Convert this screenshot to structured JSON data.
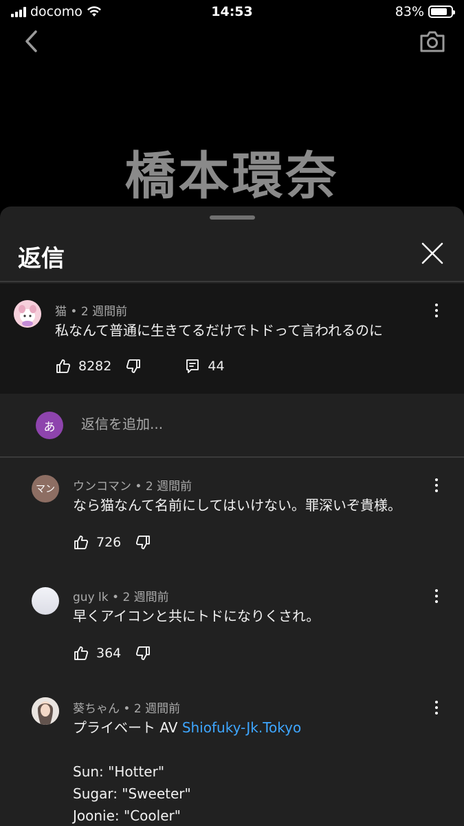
{
  "status_bar": {
    "carrier": "docomo",
    "time": "14:53",
    "battery_percent": "83%",
    "battery_level": 0.83
  },
  "video": {
    "title_overlay": "橋本環奈"
  },
  "sheet": {
    "title": "返信"
  },
  "parent_comment": {
    "author": "猫",
    "time": "2 週間前",
    "text": "私なんて普通に生きてるだけでトドって言われるのに",
    "likes": "8282",
    "replies": "44"
  },
  "add_reply": {
    "avatar_letter": "あ",
    "placeholder": "返信を追加..."
  },
  "replies": [
    {
      "author": "ウンコマン",
      "avatar_text": "マン",
      "time": "2 週間前",
      "text": "なら猫なんて名前にしてはいけない。罪深いぞ貴様。",
      "likes": "726"
    },
    {
      "author": "guy lk",
      "time": "2 週間前",
      "text": "早くアイコンと共にトドになりくされ。",
      "likes": "364"
    },
    {
      "author": "葵ちゃん",
      "time": "2 週間前",
      "text_prefix": "プライベート AV ",
      "link": "Shiofuky-Jk.Tokyo",
      "lines": [
        "Sun: \"Hotter\"",
        "Sugar: \"Sweeter\"",
        "Joonie: \"Cooler\""
      ]
    }
  ],
  "separator": " • ",
  "colors": {
    "sheet_bg": "#212121",
    "parent_bg": "#161616",
    "meta_text": "#aaaaaa",
    "link": "#3ea6ff",
    "add_avatar": "#8e44ad"
  },
  "icons": [
    "signal-icon",
    "wifi-icon",
    "battery-icon",
    "back-chevron-icon",
    "camera-icon",
    "close-icon",
    "more-vertical-icon",
    "thumb-up-icon",
    "thumb-down-icon",
    "comment-icon"
  ]
}
